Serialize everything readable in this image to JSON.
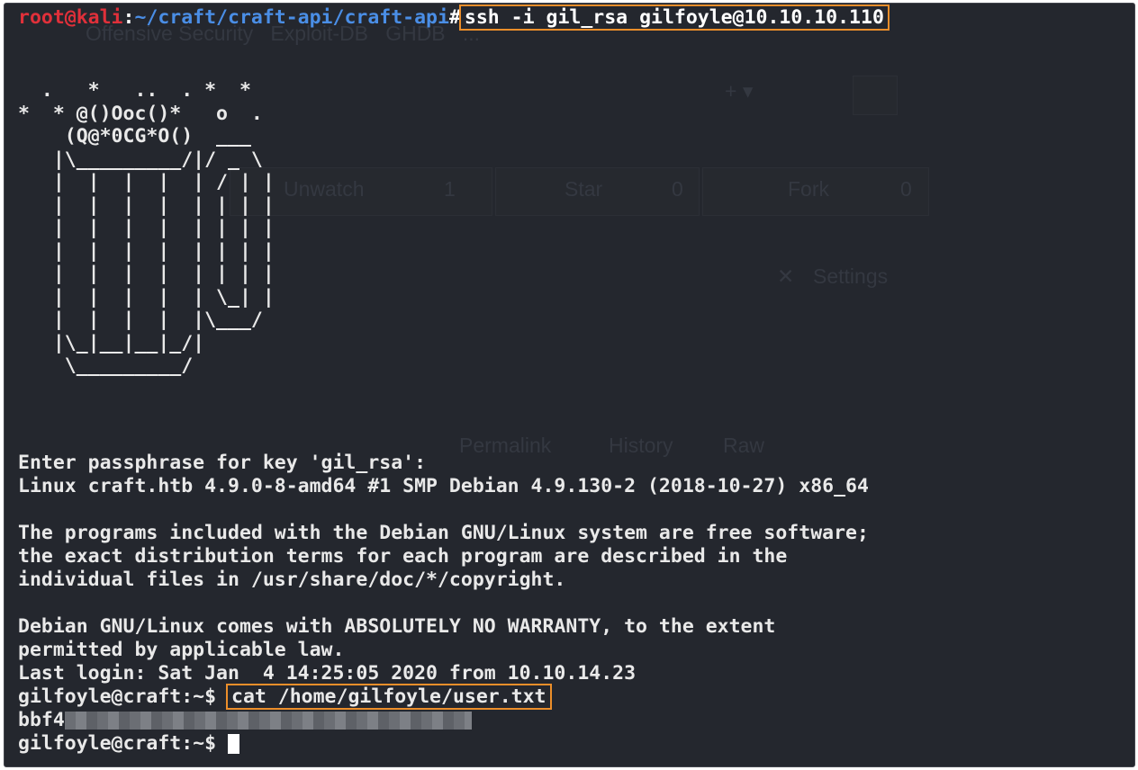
{
  "prompt1": {
    "user_host": "root@kali",
    "sep": ":",
    "path": "~/craft/craft-api/craft-api",
    "symbol": "#",
    "command": "ssh -i gil_rsa gilfoyle@10.10.10.110"
  },
  "banner_art": [
    "  .   *   ..  . *  *",
    "*  * @()Ooc()*   o  .",
    "    (Q@*0CG*O()  ___",
    "   |\\_________/|/ _ \\",
    "   |  |  |  |  | / | |",
    "   |  |  |  |  | | | |",
    "   |  |  |  |  | | | |",
    "   |  |  |  |  | | | |",
    "   |  |  |  |  | | | |",
    "   |  |  |  |  | \\_| |",
    "   |  |  |  |  |\\___/",
    "   |\\_|__|__|_/|",
    "    \\_________/"
  ],
  "output": {
    "passphrase": "Enter passphrase for key 'gil_rsa':",
    "uname": "Linux craft.htb 4.9.0-8-amd64 #1 SMP Debian 4.9.130-2 (2018-10-27) x86_64",
    "motd1": "The programs included with the Debian GNU/Linux system are free software;",
    "motd2": "the exact distribution terms for each program are described in the",
    "motd3": "individual files in /usr/share/doc/*/copyright.",
    "warranty1": "Debian GNU/Linux comes with ABSOLUTELY NO WARRANTY, to the extent",
    "warranty2": "permitted by applicable law.",
    "last_login": "Last login: Sat Jan  4 14:25:05 2020 from 10.10.14.23"
  },
  "prompt2": {
    "prompt": "gilfoyle@craft:~$ ",
    "command": "cat /home/gilfoyle/user.txt"
  },
  "flag_visible": "bbf4",
  "prompt3": {
    "prompt": "gilfoyle@craft:~$ "
  },
  "ghost_page": {
    "nav": "Offensive Security   Exploit-DB   GHDB   ...",
    "unwatch": "Unwatch",
    "unwatch_count": "1",
    "star": "Star",
    "star_count": "0",
    "fork": "Fork",
    "fork_count": "0",
    "settings": "Settings",
    "permalink": "Permalink",
    "history": "History",
    "raw": "Raw"
  },
  "colors": {
    "background": "#24272e",
    "root_red": "#e0303a",
    "path_blue": "#4a8ee6",
    "highlight_orange": "#ec8e2a"
  }
}
